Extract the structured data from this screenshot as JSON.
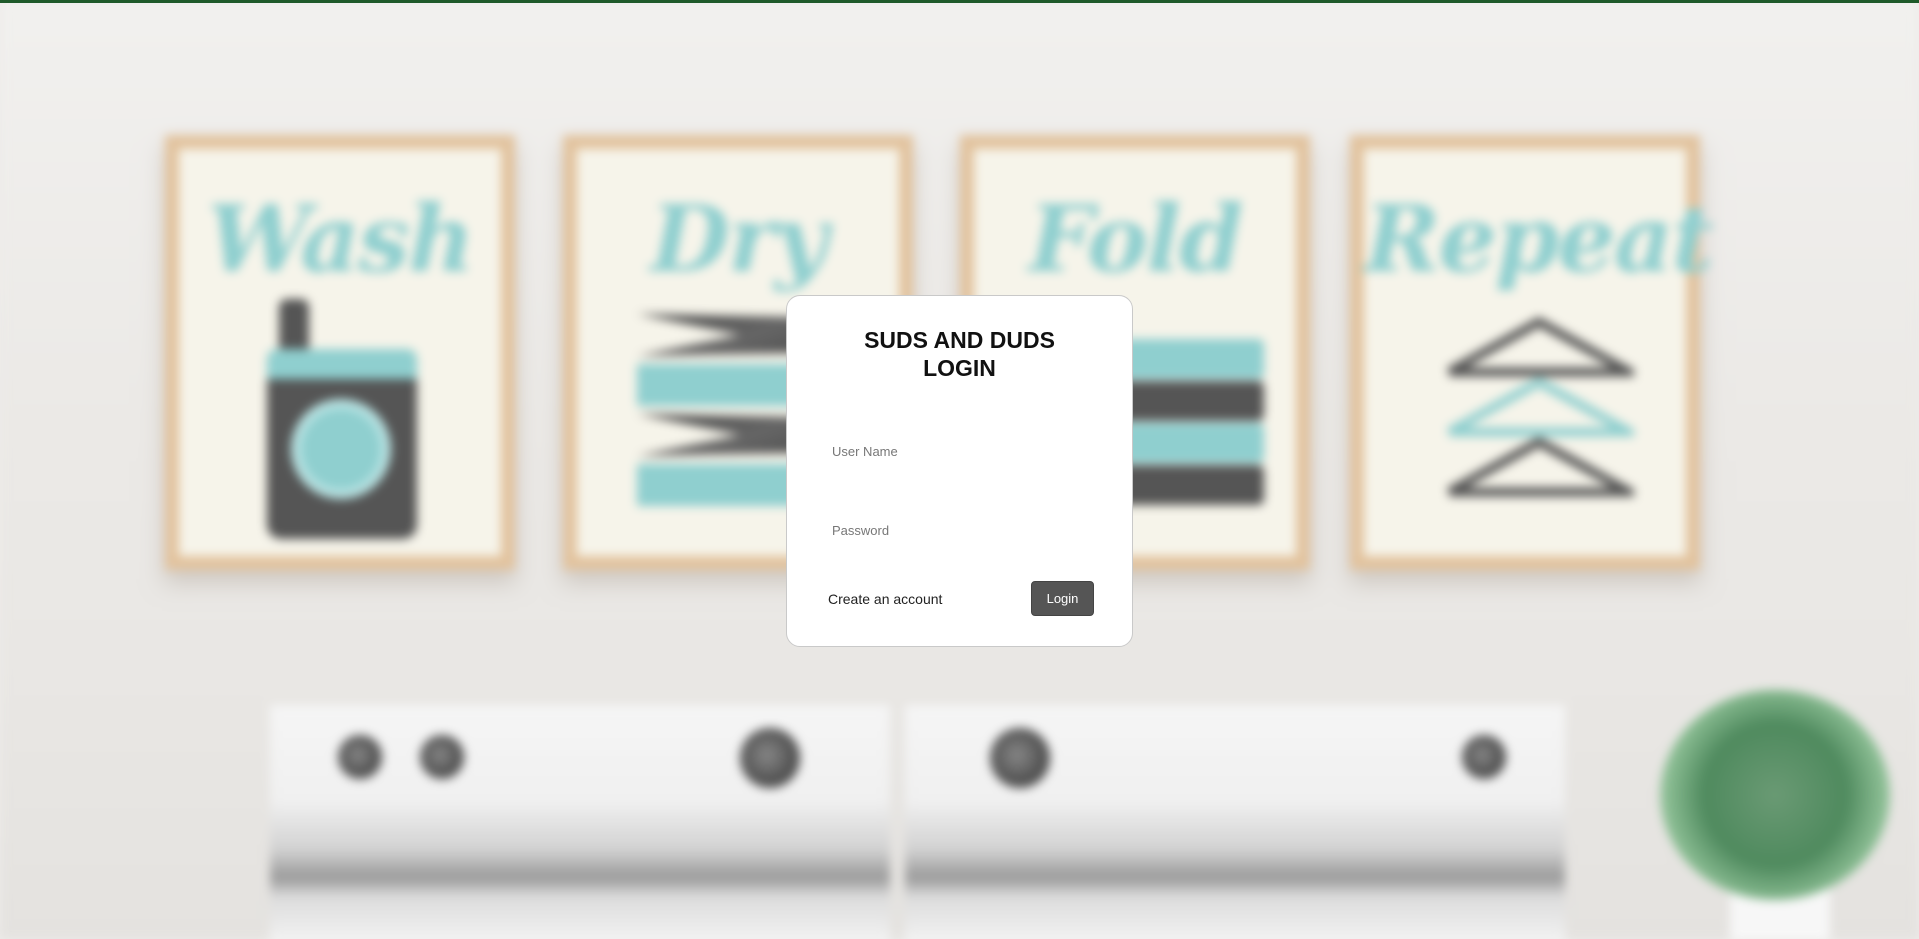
{
  "background": {
    "frames": [
      {
        "word": "Wash"
      },
      {
        "word": "Dry"
      },
      {
        "word": "Fold"
      },
      {
        "word": "Repeat"
      }
    ],
    "colors": {
      "wall": "#eeecea",
      "frame": "#e2c39e",
      "art_teal": "#8fcfcf",
      "art_dark": "#555555",
      "top_line": "#1f5a2a"
    }
  },
  "login": {
    "title": "SUDS AND DUDS\nLOGIN",
    "username_placeholder": "User Name",
    "username_value": "",
    "password_placeholder": "Password",
    "password_value": "",
    "create_account_label": "Create an account",
    "login_button_label": "Login",
    "button_color": "#555555"
  }
}
